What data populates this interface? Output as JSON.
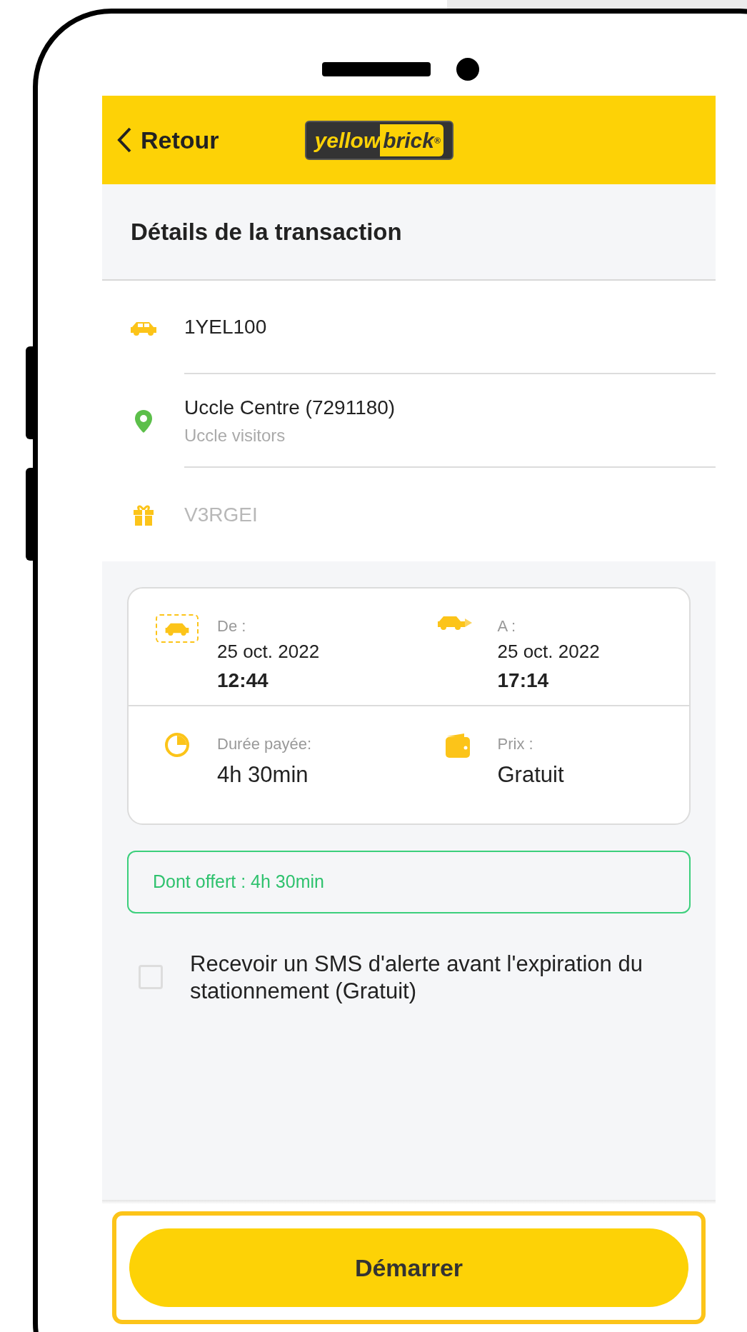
{
  "header": {
    "back_label": "Retour",
    "logo_text": "yellow",
    "logo_text_2": "brick",
    "logo_mark": "®"
  },
  "title": "Détails de la transaction",
  "info_rows": [
    {
      "kind": "plate",
      "primary": "1YEL100"
    },
    {
      "kind": "location",
      "primary": "Uccle Centre (7291180)",
      "secondary": "Uccle visitors"
    },
    {
      "kind": "voucher",
      "primary": "V3RGEI",
      "faded": true
    }
  ],
  "details": [
    {
      "kind": "start",
      "label": "De :",
      "date": "25 oct. 2022",
      "value": "12:44"
    },
    {
      "kind": "end",
      "label": "A :",
      "date": "25 oct. 2022",
      "value": "17:14"
    },
    {
      "kind": "duration",
      "label": "Durée payée:",
      "value": "4h 30min"
    },
    {
      "kind": "price",
      "label": "Prix :",
      "value": "Gratuit"
    }
  ],
  "offer_note": "Dont offert : 4h 30min",
  "sms_option": {
    "label": "Recevoir un SMS d'alerte avant l'expiration du stationnement (Gratuit)",
    "checked": false
  },
  "start_button": {
    "label": "Démarrer",
    "highlighted": true
  }
}
